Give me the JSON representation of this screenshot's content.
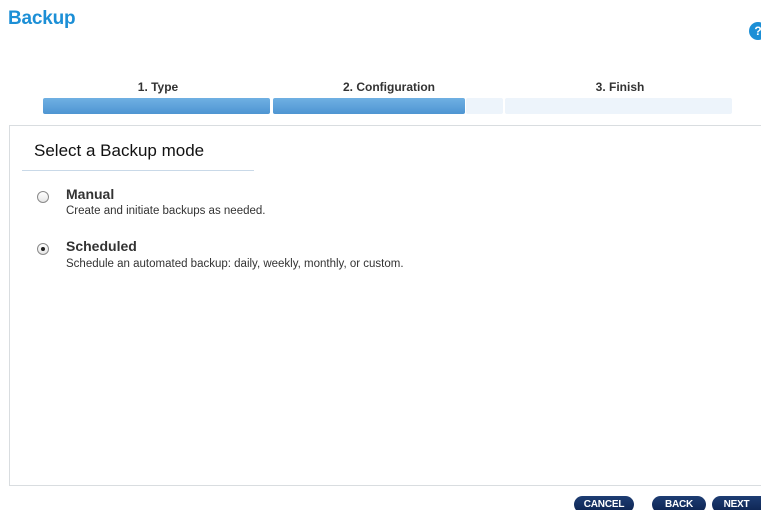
{
  "header": {
    "title": "Backup",
    "help_icon": "?"
  },
  "steps": [
    {
      "label": "1. Type"
    },
    {
      "label": "2. Configuration"
    },
    {
      "label": "3. Finish"
    }
  ],
  "main": {
    "section_title": "Select a Backup mode",
    "options": [
      {
        "title": "Manual",
        "description": "Create and initiate backups as needed.",
        "selected": false
      },
      {
        "title": "Scheduled",
        "description": "Schedule an automated backup: daily, weekly, monthly, or custom.",
        "selected": true
      }
    ]
  },
  "footer": {
    "cancel_label": "CANCEL",
    "back_label": "BACK",
    "next_label": "NEXT"
  },
  "colors": {
    "accent": "#1c8fd6",
    "progress_fill": "#5a9fd9",
    "button": "#0f2a5a"
  }
}
